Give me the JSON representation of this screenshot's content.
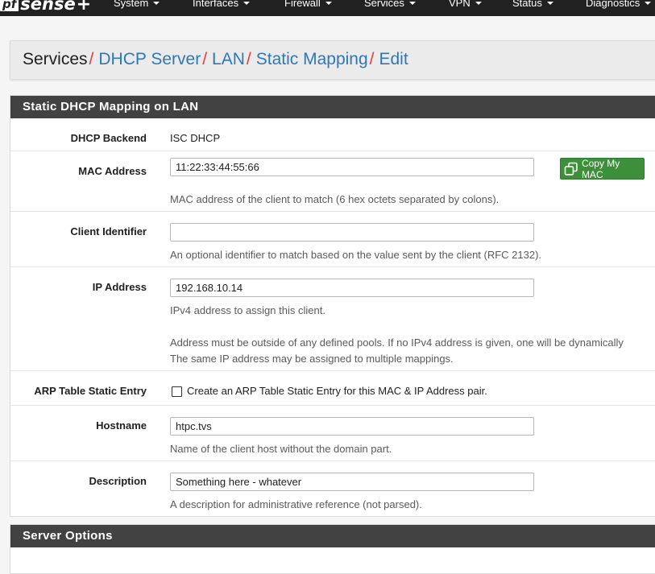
{
  "navbar": {
    "logo_pf": "pf",
    "logo_text": "sense",
    "logo_plus": "+",
    "items": [
      "System",
      "Interfaces",
      "Firewall",
      "Services",
      "VPN",
      "Status",
      "Diagnostics"
    ]
  },
  "breadcrumb": {
    "root": "Services",
    "links": [
      "DHCP Server",
      "LAN",
      "Static Mapping",
      "Edit"
    ],
    "separator": "/"
  },
  "panel": {
    "title": "Static DHCP Mapping on LAN",
    "dhcp_backend_label": "DHCP Backend",
    "dhcp_backend_value": "ISC DHCP",
    "mac_label": "MAC Address",
    "mac_value": "11:22:33:44:55:66",
    "copy_mac_label": "Copy My MAC",
    "mac_help": "MAC address of the client to match (6 hex octets separated by colons).",
    "client_id_label": "Client Identifier",
    "client_id_value": "",
    "client_id_help": "An optional identifier to match based on the value sent by the client (RFC 2132).",
    "ip_label": "IP Address",
    "ip_value": "192.168.10.14",
    "ip_help1": "IPv4 address to assign this client.",
    "ip_help2": "Address must be outside of any defined pools. If no IPv4 address is given, one will be dynamically",
    "ip_help3": "The same IP address may be assigned to multiple mappings.",
    "arp_label": "ARP Table Static Entry",
    "arp_checked": false,
    "arp_text": "Create an ARP Table Static Entry for this MAC & IP Address pair.",
    "hostname_label": "Hostname",
    "hostname_value": "htpc.tvs",
    "hostname_help": "Name of the client host without the domain part.",
    "description_label": "Description",
    "description_value": "Something here - whatever",
    "description_help": "A description for administrative reference (not parsed)."
  },
  "server_options": {
    "title": "Server Options"
  },
  "colors": {
    "navbar": "#212121",
    "panel_heading": "#424242",
    "link": "#2f78b6",
    "separator": "#e2403a",
    "button_green": "#3e8f3a"
  }
}
